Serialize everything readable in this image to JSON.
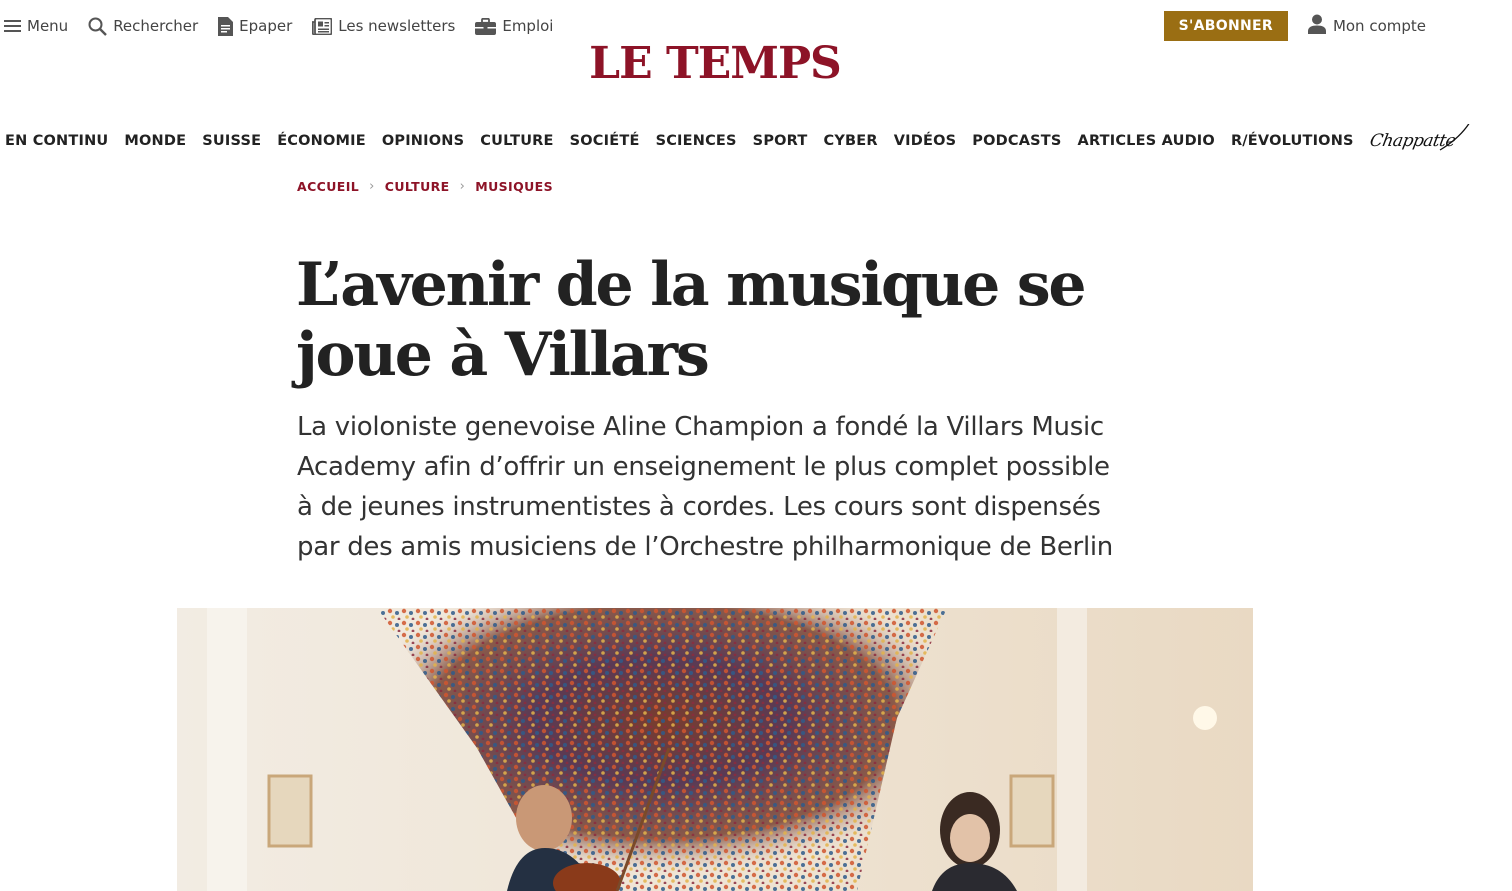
{
  "topbar": {
    "menu_label": "Menu",
    "search_label": "Rechercher",
    "epaper_label": "Epaper",
    "newsletters_label": "Les newsletters",
    "jobs_label": "Emploi",
    "subscribe_label": "S'ABONNER",
    "account_label": "Mon compte"
  },
  "brand": {
    "logo_text": "LE TEMPS",
    "logo_color": "#8d1327",
    "subscribe_color": "#9a6e13"
  },
  "nav": {
    "items": [
      "EN CONTINU",
      "MONDE",
      "SUISSE",
      "ÉCONOMIE",
      "OPINIONS",
      "CULTURE",
      "SOCIÉTÉ",
      "SCIENCES",
      "SPORT",
      "CYBER",
      "VIDÉOS",
      "PODCASTS",
      "ARTICLES AUDIO",
      "R/ÉVOLUTIONS"
    ],
    "chappatte": "Chappatte"
  },
  "breadcrumb": [
    "ACCUEIL",
    "CULTURE",
    "MUSIQUES"
  ],
  "article": {
    "headline": "L’avenir de la musique se joue à Villars",
    "lede": "La violoniste genevoise Aline Champion a fondé la Villars Music Academy afin d’offrir un enseignement le plus complet possible à de jeunes instrumentistes à cordes. Les cours sont dispensés par des amis musiciens de l’Orchestre philharmonique de Berlin"
  },
  "icons": {
    "menu": "hamburger-icon",
    "search": "search-icon",
    "epaper": "document-icon",
    "newsletters": "newspaper-icon",
    "jobs": "briefcase-icon",
    "account": "user-icon"
  }
}
